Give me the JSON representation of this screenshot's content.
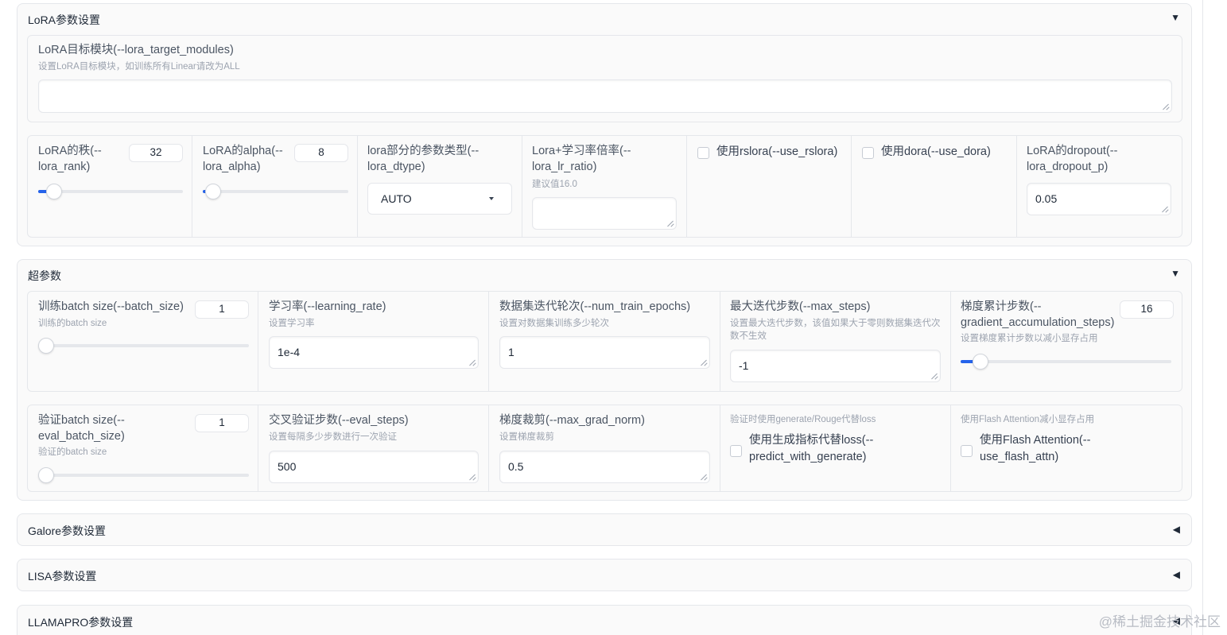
{
  "lora": {
    "title": "LoRA参数设置",
    "toggle": "▼",
    "target_modules": {
      "label": "LoRA目标模块(--lora_target_modules)",
      "info": "设置LoRA目标模块，如训练所有Linear请改为ALL",
      "value": ""
    },
    "rank": {
      "label": "LoRA的秩(--lora_rank)",
      "value": "32",
      "slider_fraction": 0.06
    },
    "alpha": {
      "label": "LoRA的alpha(--lora_alpha)",
      "value": "8",
      "slider_fraction": 0.02
    },
    "dtype": {
      "label": "lora部分的参数类型(--lora_dtype)",
      "value": "AUTO"
    },
    "lr_ratio": {
      "label": "Lora+学习率倍率(--lora_lr_ratio)",
      "info": "建议值16.0",
      "value": ""
    },
    "rslora": {
      "label": "使用rslora(--use_rslora)",
      "checked": false
    },
    "dora": {
      "label": "使用dora(--use_dora)",
      "checked": false
    },
    "dropout": {
      "label": "LoRA的dropout(--lora_dropout_p)",
      "value": "0.05"
    }
  },
  "hyper": {
    "title": "超参数",
    "toggle": "▼",
    "batch_size": {
      "label": "训练batch size(--batch_size)",
      "info": "训练的batch size",
      "value": "1",
      "slider_fraction": 0.0
    },
    "learning_rate": {
      "label": "学习率(--learning_rate)",
      "info": "设置学习率",
      "value": "1e-4"
    },
    "epochs": {
      "label": "数据集迭代轮次(--num_train_epochs)",
      "info": "设置对数据集训练多少轮次",
      "value": "1"
    },
    "max_steps": {
      "label": "最大迭代步数(--max_steps)",
      "info": "设置最大迭代步数，该值如果大于零则数据集迭代次数不生效",
      "value": "-1"
    },
    "grad_accum": {
      "label": "梯度累计步数(--gradient_accumulation_steps)",
      "info": "设置梯度累计步数以减小显存占用",
      "value": "16",
      "slider_fraction": 0.06
    },
    "eval_batch_size": {
      "label": "验证batch size(--eval_batch_size)",
      "info": "验证的batch size",
      "value": "1",
      "slider_fraction": 0.0
    },
    "eval_steps": {
      "label": "交叉验证步数(--eval_steps)",
      "info": "设置每隔多少步数进行一次验证",
      "value": "500"
    },
    "max_grad_norm": {
      "label": "梯度裁剪(--max_grad_norm)",
      "info": "设置梯度裁剪",
      "value": "0.5"
    },
    "predict_with_generate": {
      "header": "验证时使用generate/Rouge代替loss",
      "label": "使用生成指标代替loss(--predict_with_generate)",
      "checked": false
    },
    "flash_attn": {
      "header": "使用Flash Attention减小显存占用",
      "label": "使用Flash Attention(--use_flash_attn)",
      "checked": false
    }
  },
  "galore": {
    "title": "Galore参数设置",
    "toggle": "◀"
  },
  "lisa": {
    "title": "LISA参数设置",
    "toggle": "◀"
  },
  "llamapro": {
    "title": "LLAMAPRO参数设置",
    "toggle": "◀"
  },
  "watermark": "@稀土掘金技术社区"
}
